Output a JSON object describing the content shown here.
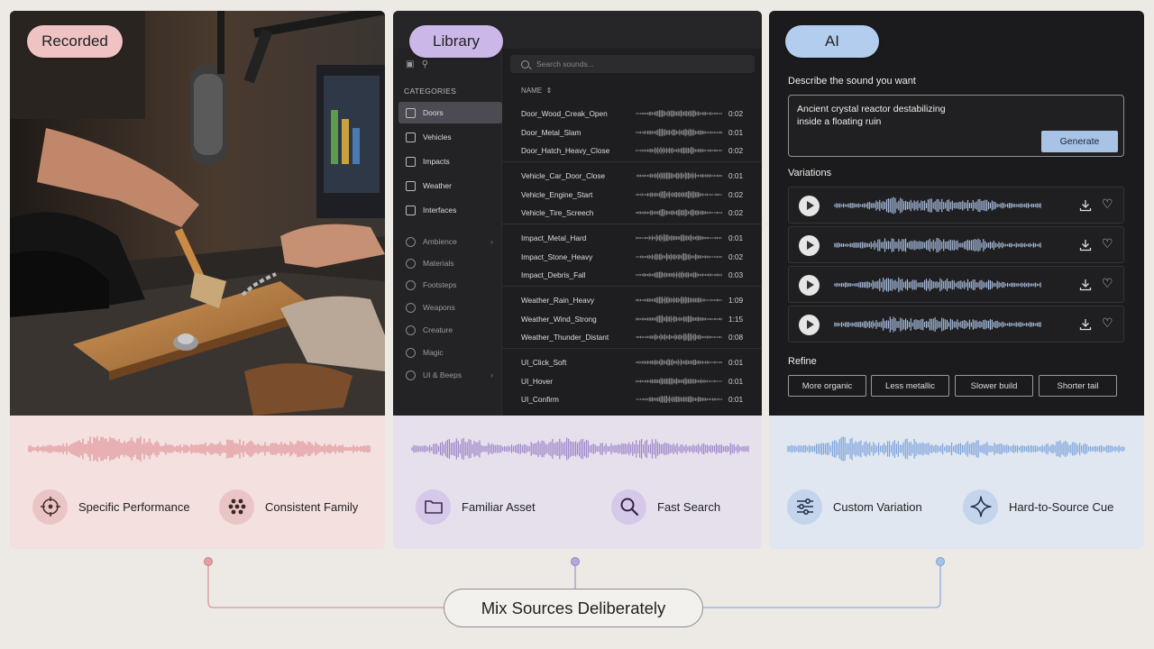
{
  "tags": {
    "recorded": "Recorded",
    "library": "Library",
    "ai": "AI"
  },
  "library": {
    "search_placeholder": "Search sounds...",
    "categories_title": "CATEGORIES",
    "name_header": "NAME",
    "categories": [
      {
        "label": "Doors",
        "active": true
      },
      {
        "label": "Vehicles"
      },
      {
        "label": "Impacts"
      },
      {
        "label": "Weather"
      },
      {
        "label": "Interfaces"
      }
    ],
    "more_categories": [
      "Ambience",
      "Materials",
      "Footsteps",
      "Weapons",
      "Creature",
      "Magic",
      "UI & Beeps"
    ],
    "sounds": [
      {
        "name": "Door_Wood_Creak_Open",
        "duration": "0:02"
      },
      {
        "name": "Door_Metal_Slam",
        "duration": "0:01"
      },
      {
        "name": "Door_Hatch_Heavy_Close",
        "duration": "0:02"
      },
      {
        "name": "Vehicle_Car_Door_Close",
        "duration": "0:01"
      },
      {
        "name": "Vehicle_Engine_Start",
        "duration": "0:02"
      },
      {
        "name": "Vehicle_Tire_Screech",
        "duration": "0:02"
      },
      {
        "name": "Impact_Metal_Hard",
        "duration": "0:01"
      },
      {
        "name": "Impact_Stone_Heavy",
        "duration": "0:02"
      },
      {
        "name": "Impact_Debris_Fall",
        "duration": "0:03"
      },
      {
        "name": "Weather_Rain_Heavy",
        "duration": "1:09"
      },
      {
        "name": "Weather_Wind_Strong",
        "duration": "1:15"
      },
      {
        "name": "Weather_Thunder_Distant",
        "duration": "0:08"
      },
      {
        "name": "UI_Click_Soft",
        "duration": "0:01"
      },
      {
        "name": "UI_Hover",
        "duration": "0:01"
      },
      {
        "name": "UI_Confirm",
        "duration": "0:01"
      }
    ]
  },
  "ai": {
    "describe_label": "Describe the sound you want",
    "prompt_line1": "Ancient crystal reactor destabilizing",
    "prompt_line2": "inside a floating ruin",
    "generate_label": "Generate",
    "variations_label": "Variations",
    "variation_count": 4,
    "refine_label": "Refine",
    "refine_options": [
      "More organic",
      "Less metallic",
      "Slower build",
      "Shorter tail"
    ]
  },
  "features": {
    "recorded": [
      "Specific Performance",
      "Consistent Family"
    ],
    "library": [
      "Familiar Asset",
      "Fast Search"
    ],
    "ai": [
      "Custom Variation",
      "Hard-to-Source Cue"
    ]
  },
  "colors": {
    "recorded_accent": "#e08f94",
    "library_accent": "#9d85c9",
    "ai_accent": "#7da3dc",
    "recorded_tag": "#efc3c4",
    "library_tag": "#ccb8e8",
    "ai_tag": "#b3cdee"
  },
  "icons": {
    "recorded": [
      "crosshair-icon",
      "dots-cluster-icon"
    ],
    "library": [
      "folder-icon",
      "search-icon"
    ],
    "ai": [
      "sliders-icon",
      "sparkle-icon"
    ]
  },
  "footer": {
    "label": "Mix Sources Deliberately"
  }
}
